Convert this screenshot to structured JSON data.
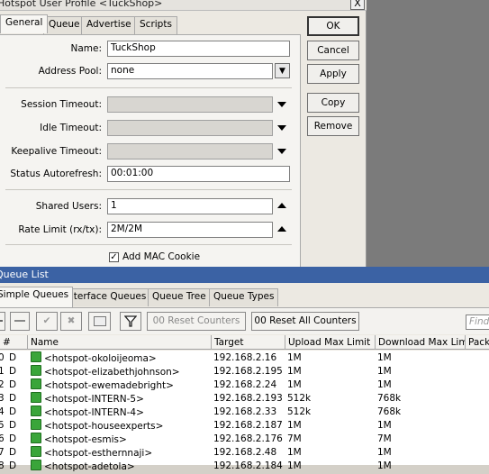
{
  "profile_window": {
    "title": "Hotspot User Profile <TuckShop>",
    "close_label": "X",
    "tabs": [
      "General",
      "Queue",
      "Advertise",
      "Scripts"
    ],
    "fields": {
      "name": {
        "label": "Name:",
        "value": "TuckShop"
      },
      "address_pool": {
        "label": "Address Pool:",
        "value": "none"
      },
      "session_timeout": {
        "label": "Session Timeout:",
        "value": ""
      },
      "idle_timeout": {
        "label": "Idle Timeout:",
        "value": ""
      },
      "keepalive_timeout": {
        "label": "Keepalive Timeout:",
        "value": ""
      },
      "status_autorefresh": {
        "label": "Status Autorefresh:",
        "value": "00:01:00"
      },
      "shared_users": {
        "label": "Shared Users:",
        "value": "1"
      },
      "rate_limit": {
        "label": "Rate Limit (rx/tx):",
        "value": "2M/2M"
      },
      "add_mac_cookie": {
        "label": "Add MAC Cookie",
        "checked": true
      }
    },
    "buttons": [
      "OK",
      "Cancel",
      "Apply",
      "Copy",
      "Remove"
    ]
  },
  "queue_list": {
    "title": "Queue List",
    "tabs": [
      "Simple Queues",
      "Interface Queues",
      "Queue Tree",
      "Queue Types"
    ],
    "toolbar": {
      "reset_counters": "00  Reset Counters",
      "reset_all_counters": "00  Reset All Counters",
      "find_placeholder": "Find"
    },
    "columns": [
      "#",
      "Name",
      "Target",
      "Upload Max Limit",
      "Download Max Limit",
      "Packets"
    ],
    "rows": [
      {
        "num": "0",
        "flag": "D",
        "name": "<hotspot-okoloijeoma>",
        "target": "192.168.2.16",
        "upload": "1M",
        "download": "1M"
      },
      {
        "num": "1",
        "flag": "D",
        "name": "<hotspot-elizabethjohnson>",
        "target": "192.168.2.195",
        "upload": "1M",
        "download": "1M"
      },
      {
        "num": "2",
        "flag": "D",
        "name": "<hotspot-ewemadebright>",
        "target": "192.168.2.24",
        "upload": "1M",
        "download": "1M"
      },
      {
        "num": "3",
        "flag": "D",
        "name": "<hotspot-INTERN-5>",
        "target": "192.168.2.193",
        "upload": "512k",
        "download": "768k"
      },
      {
        "num": "4",
        "flag": "D",
        "name": "<hotspot-INTERN-4>",
        "target": "192.168.2.33",
        "upload": "512k",
        "download": "768k"
      },
      {
        "num": "5",
        "flag": "D",
        "name": "<hotspot-houseexperts>",
        "target": "192.168.2.187",
        "upload": "1M",
        "download": "1M"
      },
      {
        "num": "6",
        "flag": "D",
        "name": "<hotspot-esmis>",
        "target": "192.168.2.176",
        "upload": "7M",
        "download": "7M"
      },
      {
        "num": "7",
        "flag": "D",
        "name": "<hotspot-esthernnaji>",
        "target": "192.168.2.48",
        "upload": "1M",
        "download": "1M"
      },
      {
        "num": "8",
        "flag": "D",
        "name": "<hotspot-adetola>",
        "target": "192.168.2.184",
        "upload": "1M",
        "download": "1M"
      }
    ]
  }
}
